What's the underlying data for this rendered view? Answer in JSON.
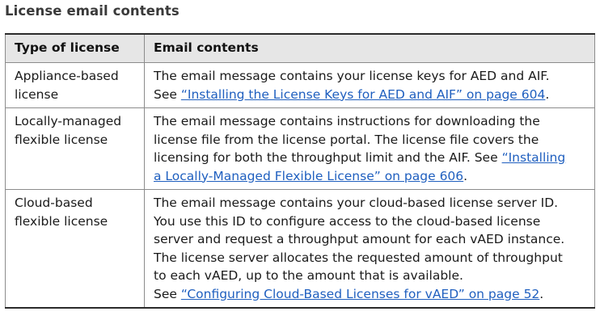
{
  "section_title": "License email contents",
  "table": {
    "headers": [
      "Type of license",
      "Email contents"
    ],
    "rows": [
      {
        "type_lines": [
          "Appliance-based",
          "license"
        ],
        "content": {
          "l1": "The email message contains your license keys for AED and AIF.",
          "l2_pre": "See ",
          "link": "“Installing the License Keys for AED and AIF” on page 604",
          "l2_post": "."
        }
      },
      {
        "type_lines": [
          "Locally-managed",
          "flexible license"
        ],
        "content": {
          "l1": "The email message contains instructions for downloading the",
          "l2": "license file from the license portal. The license file covers the",
          "l3_pre": "licensing for both the throughput limit and the AIF. See ",
          "link_part1": "“Installing",
          "link_part2": "a Locally-Managed Flexible License” on page 606",
          "l4_post": "."
        }
      },
      {
        "type_lines": [
          "Cloud-based",
          "flexible license"
        ],
        "content": {
          "l1": "The email message contains your cloud-based license server ID.",
          "l2": "You use this ID to configure access to the cloud-based license",
          "l3": "server and request a throughput amount for each vAED instance.",
          "l4": "The license server allocates the requested amount of throughput",
          "l5": "to each vAED, up to the amount that is available.",
          "l6_pre": "See ",
          "link": "“Configuring Cloud-Based Licenses for vAED” on page 52",
          "l6_post": "."
        }
      }
    ]
  }
}
